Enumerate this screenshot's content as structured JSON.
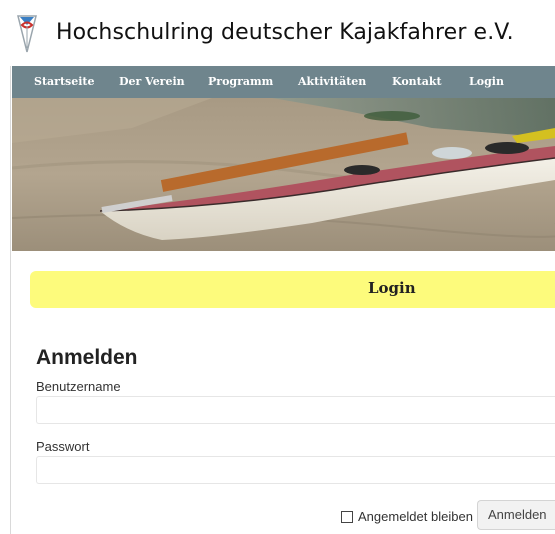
{
  "site": {
    "title": "Hochschulring deutscher Kajakfahrer e.V."
  },
  "nav": {
    "items": [
      {
        "label": "Startseite"
      },
      {
        "label": "Der Verein"
      },
      {
        "label": "Programm"
      },
      {
        "label": "Aktivitäten"
      },
      {
        "label": "Kontakt"
      },
      {
        "label": "Login"
      }
    ]
  },
  "page": {
    "banner_title": "Login"
  },
  "login_form": {
    "heading": "Anmelden",
    "username_label": "Benutzername",
    "username_value": "",
    "password_label": "Passwort",
    "password_value": "",
    "remember_label": "Angemeldet bleiben",
    "remember_checked": false,
    "submit_label": "Anmelden"
  },
  "colors": {
    "nav_background": "#6f858d",
    "banner_background": "#fdfb7c",
    "logo_blue": "#3a7fc4",
    "logo_red": "#c9302c"
  }
}
